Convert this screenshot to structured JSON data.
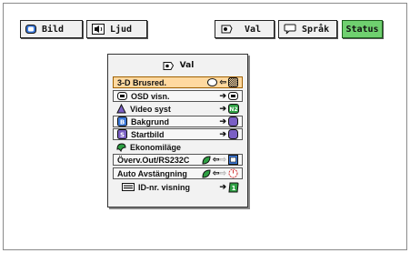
{
  "tabs": {
    "bild": "Bild",
    "ljud": "Ljud",
    "val": "Val",
    "sprak": "Språk",
    "status": "Status"
  },
  "panel": {
    "title": "Val",
    "items": [
      {
        "label": "3-D Brusred.",
        "icon": "none",
        "state_icon": "oval-off-icon",
        "alt_icon": "checker-pattern-icon",
        "selected": true
      },
      {
        "label": "OSD visn.",
        "icon": "osd-icon",
        "state_icon": "osd-state-icon"
      },
      {
        "label": "Video syst",
        "icon": "video-system-icon",
        "state_icon": "n2-badge-icon"
      },
      {
        "label": "Bakgrund",
        "icon": "background-b-icon",
        "state_icon": "rounded-square-icon"
      },
      {
        "label": "Startbild",
        "icon": "startbild-s-icon",
        "state_icon": "rounded-square-icon"
      },
      {
        "label": "Ekonomiläge",
        "icon": "eco-leaf-icon",
        "state_icon": "none"
      },
      {
        "label": "Överv.Out/RS232C",
        "icon": "none",
        "state_icon": "leaf-icon",
        "alt_icon": "monitor-out-icon"
      },
      {
        "label": "Auto Avstängning",
        "icon": "none",
        "state_icon": "leaf-icon",
        "alt_icon": "power-off-icon"
      },
      {
        "label": "ID-nr. visning",
        "icon": "id-card-icon",
        "state_icon": "number-one-badge-icon"
      }
    ]
  },
  "colors": {
    "selected_row": "#ffd9a0",
    "status_tab": "#6fd06f",
    "accent_green": "#2ea043",
    "accent_blue": "#3b78d8",
    "accent_purple": "#7a5fc4"
  }
}
